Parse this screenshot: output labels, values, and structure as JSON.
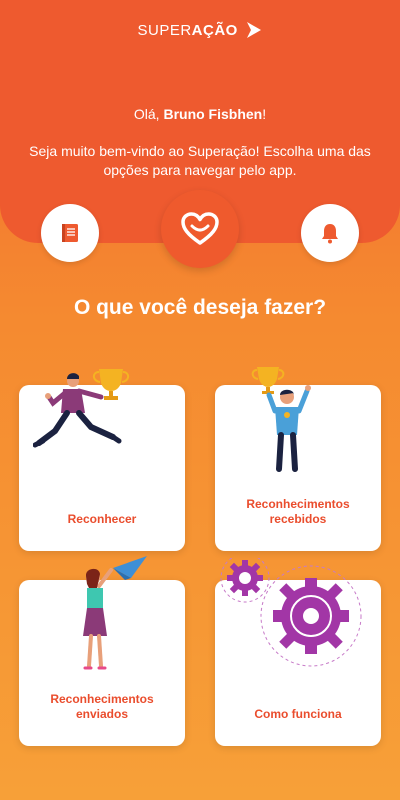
{
  "brand": {
    "logo_part1": "SUPER",
    "logo_part2": "AÇÃO"
  },
  "header": {
    "greeting_prefix": "Olá, ",
    "user_name": "Bruno Fisbhen",
    "greeting_suffix": "!",
    "welcome": "Seja muito bem-vindo ao Superação! Escolha uma das opções para navegar pelo app."
  },
  "nav": {
    "left_icon": "book-icon",
    "center_icon": "heart-icon",
    "right_icon": "bell-icon"
  },
  "question": "O que você deseja fazer?",
  "cards": [
    {
      "label": "Reconhecer",
      "illustration": "runner-with-trophy"
    },
    {
      "label": "Reconhecimentos recebidos",
      "illustration": "person-raising-trophy"
    },
    {
      "label": "Reconhecimentos enviados",
      "illustration": "woman-paper-plane"
    },
    {
      "label": "Como funciona",
      "illustration": "gears"
    }
  ],
  "colors": {
    "primary": "#ee5a2f",
    "accent": "#ea4d2d",
    "purple": "#a236a6"
  }
}
